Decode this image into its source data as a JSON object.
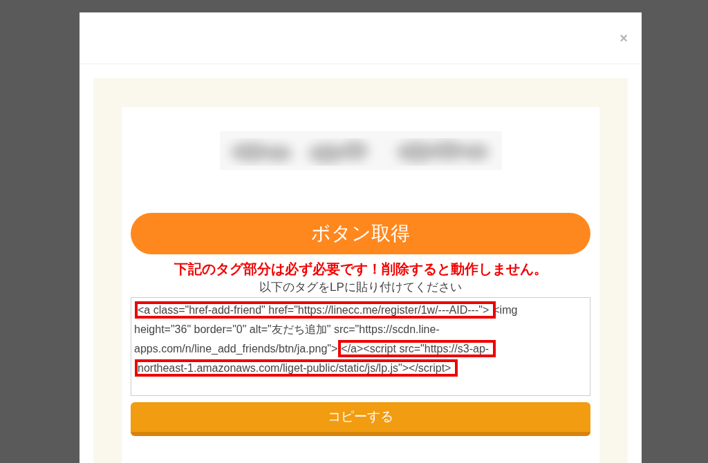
{
  "modal": {
    "close": "×",
    "get_button": "ボタン取得",
    "warning": "下記のタグ部分は必ず必要です！削除すると動作しません。",
    "instruction": "以下のタグをLPに貼り付けてください",
    "code_lines": [
      [
        {
          "text": "<a class=\"href-add-friend\" href=\"https://linecc.me/register/1w/---AID---\">",
          "highlighted": true
        },
        {
          "text": "<img",
          "highlighted": false
        }
      ],
      [
        {
          "text": "height=\"36\" border=\"0\" alt=\"友だち追加\" src=\"https://scdn.line-",
          "highlighted": false
        }
      ],
      [
        {
          "text": "apps.com/n/line_add_friends/btn/ja.png\">",
          "highlighted": false
        },
        {
          "text": "</a><script src=\"https://s3-ap-",
          "highlighted": true
        }
      ],
      [
        {
          "text": "northeast-1.amazonaws.com/liget-public/static/js/lp.js\"></script>",
          "highlighted": true
        }
      ]
    ],
    "copy_button": "コピーする"
  }
}
